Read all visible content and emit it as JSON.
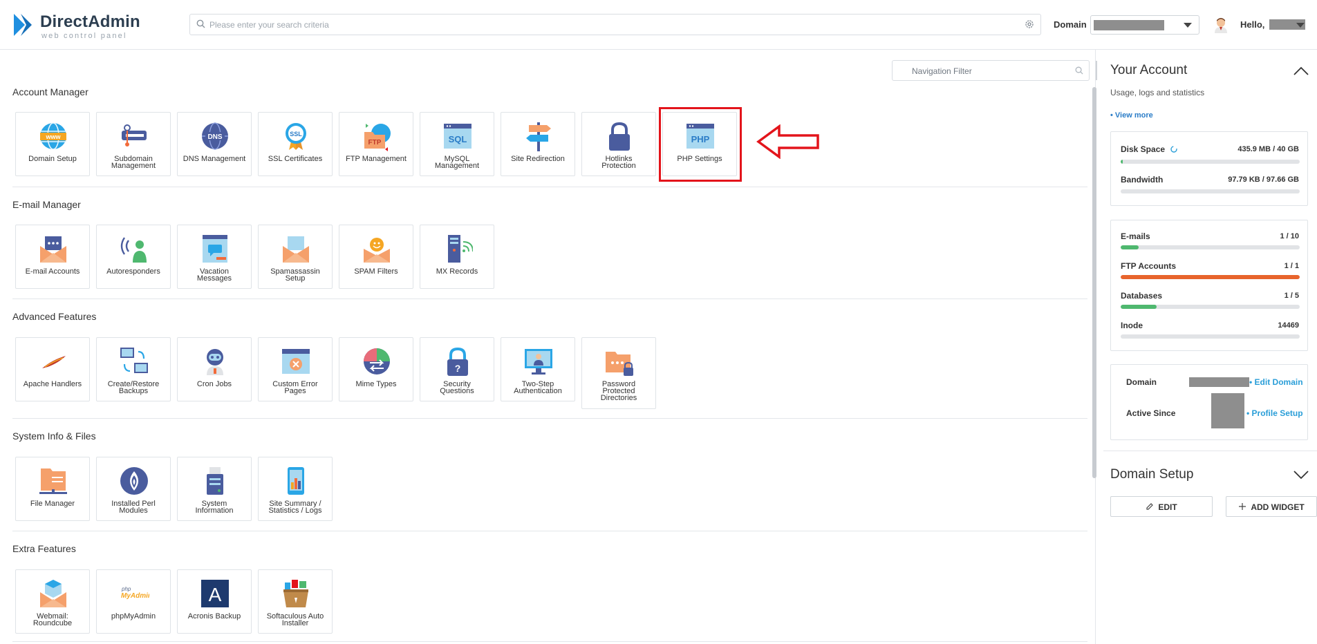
{
  "header": {
    "logo_name": "DirectAdmin",
    "logo_sub": "web control panel",
    "search_placeholder": "Please enter your search criteria",
    "domain_label": "Domain",
    "hello": "Hello,"
  },
  "nav_filter_placeholder": "Navigation Filter",
  "sections": {
    "account": {
      "title": "Account Manager",
      "items": [
        "Domain Setup",
        "Subdomain\nManagement",
        "DNS Management",
        "SSL Certificates",
        "FTP Management",
        "MySQL\nManagement",
        "Site Redirection",
        "Hotlinks\nProtection",
        "PHP Settings"
      ]
    },
    "email": {
      "title": "E-mail Manager",
      "items": [
        "E-mail Accounts",
        "Autoresponders",
        "Vacation\nMessages",
        "Spamassassin\nSetup",
        "SPAM Filters",
        "MX Records"
      ]
    },
    "advanced": {
      "title": "Advanced Features",
      "items": [
        "Apache Handlers",
        "Create/Restore\nBackups",
        "Cron Jobs",
        "Custom Error\nPages",
        "Mime Types",
        "Security\nQuestions",
        "Two-Step\nAuthentication",
        "Password\nProtected\nDirectories"
      ]
    },
    "system": {
      "title": "System Info & Files",
      "items": [
        "File Manager",
        "Installed Perl\nModules",
        "System\nInformation",
        "Site Summary /\nStatistics / Logs"
      ]
    },
    "extra": {
      "title": "Extra Features",
      "items": [
        "Webmail:\nRoundcube",
        "phpMyAdmin",
        "Acronis Backup",
        "Softaculous Auto\nInstaller"
      ]
    }
  },
  "icon_texts": {
    "www": "www",
    "dns": "DNS",
    "ssl": "SSL",
    "ftp": "FTP",
    "sql": "SQL",
    "php": "PHP",
    "pma_php": "php",
    "pma_name": "MyAdmin",
    "acronis": "A"
  },
  "account_panel": {
    "title": "Your Account",
    "subtitle": "Usage, logs and statistics",
    "view_more": "• View more",
    "disk": {
      "label": "Disk Space",
      "value": "435.9 MB / 40 GB",
      "fraction": 0.011,
      "color": "#4fb86f"
    },
    "bandwidth": {
      "label": "Bandwidth",
      "value": "97.79 KB / 97.66 GB",
      "fraction": 0.0,
      "color": "#4fb86f"
    },
    "emails": {
      "label": "E-mails",
      "value": "1 / 10",
      "fraction": 0.1,
      "color": "#4fb86f"
    },
    "ftp": {
      "label": "FTP Accounts",
      "value": "1 / 1",
      "fraction": 1.0,
      "color": "#e8642c"
    },
    "databases": {
      "label": "Databases",
      "value": "1 / 5",
      "fraction": 0.2,
      "color": "#4fb86f"
    },
    "inode": {
      "label": "Inode",
      "value": "14469",
      "fraction": 0.0,
      "color": "#4fb86f"
    },
    "domain_label": "Domain",
    "edit_domain": "• Edit Domain",
    "active_since": "Active Since",
    "profile_setup": "• Profile Setup"
  },
  "domain_setup_panel": {
    "title": "Domain Setup",
    "edit": "EDIT",
    "add_widget": "ADD WIDGET"
  },
  "colors": {
    "accent": "#2a7cc7",
    "highlight": "#e3141b",
    "ftp_bar": "#e8642c",
    "ok_bar": "#4fb86f"
  }
}
